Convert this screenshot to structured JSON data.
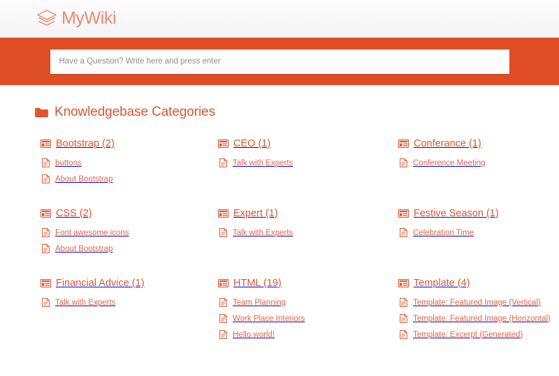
{
  "header": {
    "brand_name": "MyWiki",
    "brand_icon": "layers-stack-icon"
  },
  "search": {
    "placeholder": "Have a Question? Write here and press enter",
    "value": ""
  },
  "main": {
    "heading": "Knowledgebase Categories",
    "heading_icon": "folder-icon"
  },
  "colors": {
    "accent_orange": "#e04e27",
    "link_orange": "#e0552e",
    "article_orange": "#e3664a",
    "brand_salmon": "#ec8a72",
    "header_bg": "#f7f6f5",
    "page_bg": "#ffffff"
  },
  "categories": [
    {
      "title": "Bootstrap (2)",
      "articles": [
        "buttons",
        "About Bootstrap"
      ]
    },
    {
      "title": "CEO (1)",
      "articles": [
        "Talk with Experts"
      ]
    },
    {
      "title": "Conferance (1)",
      "articles": [
        "Conference Meeting"
      ]
    },
    {
      "title": "CSS (2)",
      "articles": [
        "Font awesome icons",
        "About Bootstrap"
      ]
    },
    {
      "title": "Expert (1)",
      "articles": [
        "Talk with Experts"
      ]
    },
    {
      "title": "Festive Season (1)",
      "articles": [
        "Celebration Time"
      ]
    },
    {
      "title": "Financial Advice (1)",
      "articles": [
        "Talk with Experts"
      ]
    },
    {
      "title": "HTML (19)",
      "articles": [
        "Team Planning",
        "Work Place Interiors",
        "Hello world!"
      ]
    },
    {
      "title": "Template (4)",
      "articles": [
        "Template: Featured Image (Vertical)",
        "Template: Featured Image (Horizontal)",
        "Template: Excerpt (Generated)"
      ]
    }
  ]
}
